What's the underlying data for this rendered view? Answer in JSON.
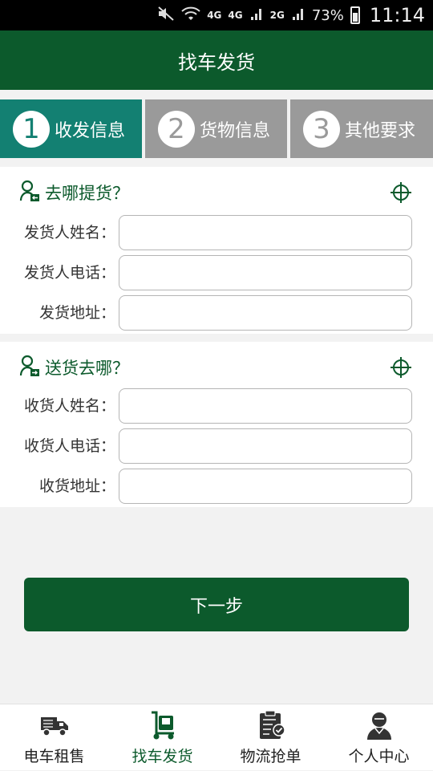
{
  "status_bar": {
    "network_label": "4G",
    "signal1_label": "4G",
    "signal2_label": "2G",
    "battery_percent": "73%",
    "time": "11:14"
  },
  "header": {
    "title": "找车发货"
  },
  "steps": [
    {
      "number": "1",
      "label": "收发信息",
      "active": true
    },
    {
      "number": "2",
      "label": "货物信息",
      "active": false
    },
    {
      "number": "3",
      "label": "其他要求",
      "active": false
    }
  ],
  "pickup": {
    "title": "去哪提货？",
    "fields": [
      {
        "label": "发货人姓名：",
        "value": "",
        "placeholder": ""
      },
      {
        "label": "发货人电话：",
        "value": "",
        "placeholder": ""
      },
      {
        "label": "发货地址：",
        "value": "",
        "placeholder": ""
      }
    ]
  },
  "delivery": {
    "title": "送货去哪？",
    "fields": [
      {
        "label": "收货人姓名：",
        "value": "",
        "placeholder": ""
      },
      {
        "label": "收货人电话：",
        "value": "",
        "placeholder": ""
      },
      {
        "label": "收货地址：",
        "value": "",
        "placeholder": ""
      }
    ]
  },
  "next_button": {
    "label": "下一步"
  },
  "bottom_nav": [
    {
      "label": "电车租售",
      "icon": "truck-icon",
      "active": false
    },
    {
      "label": "找车发货",
      "icon": "cart-dolly-icon",
      "active": true
    },
    {
      "label": "物流抢单",
      "icon": "clipboard-check-icon",
      "active": false
    },
    {
      "label": "个人中心",
      "icon": "person-icon",
      "active": false
    }
  ],
  "colors": {
    "primary": "#0c5a2c",
    "step_active": "#138072",
    "step_inactive": "#9a9a9a"
  }
}
